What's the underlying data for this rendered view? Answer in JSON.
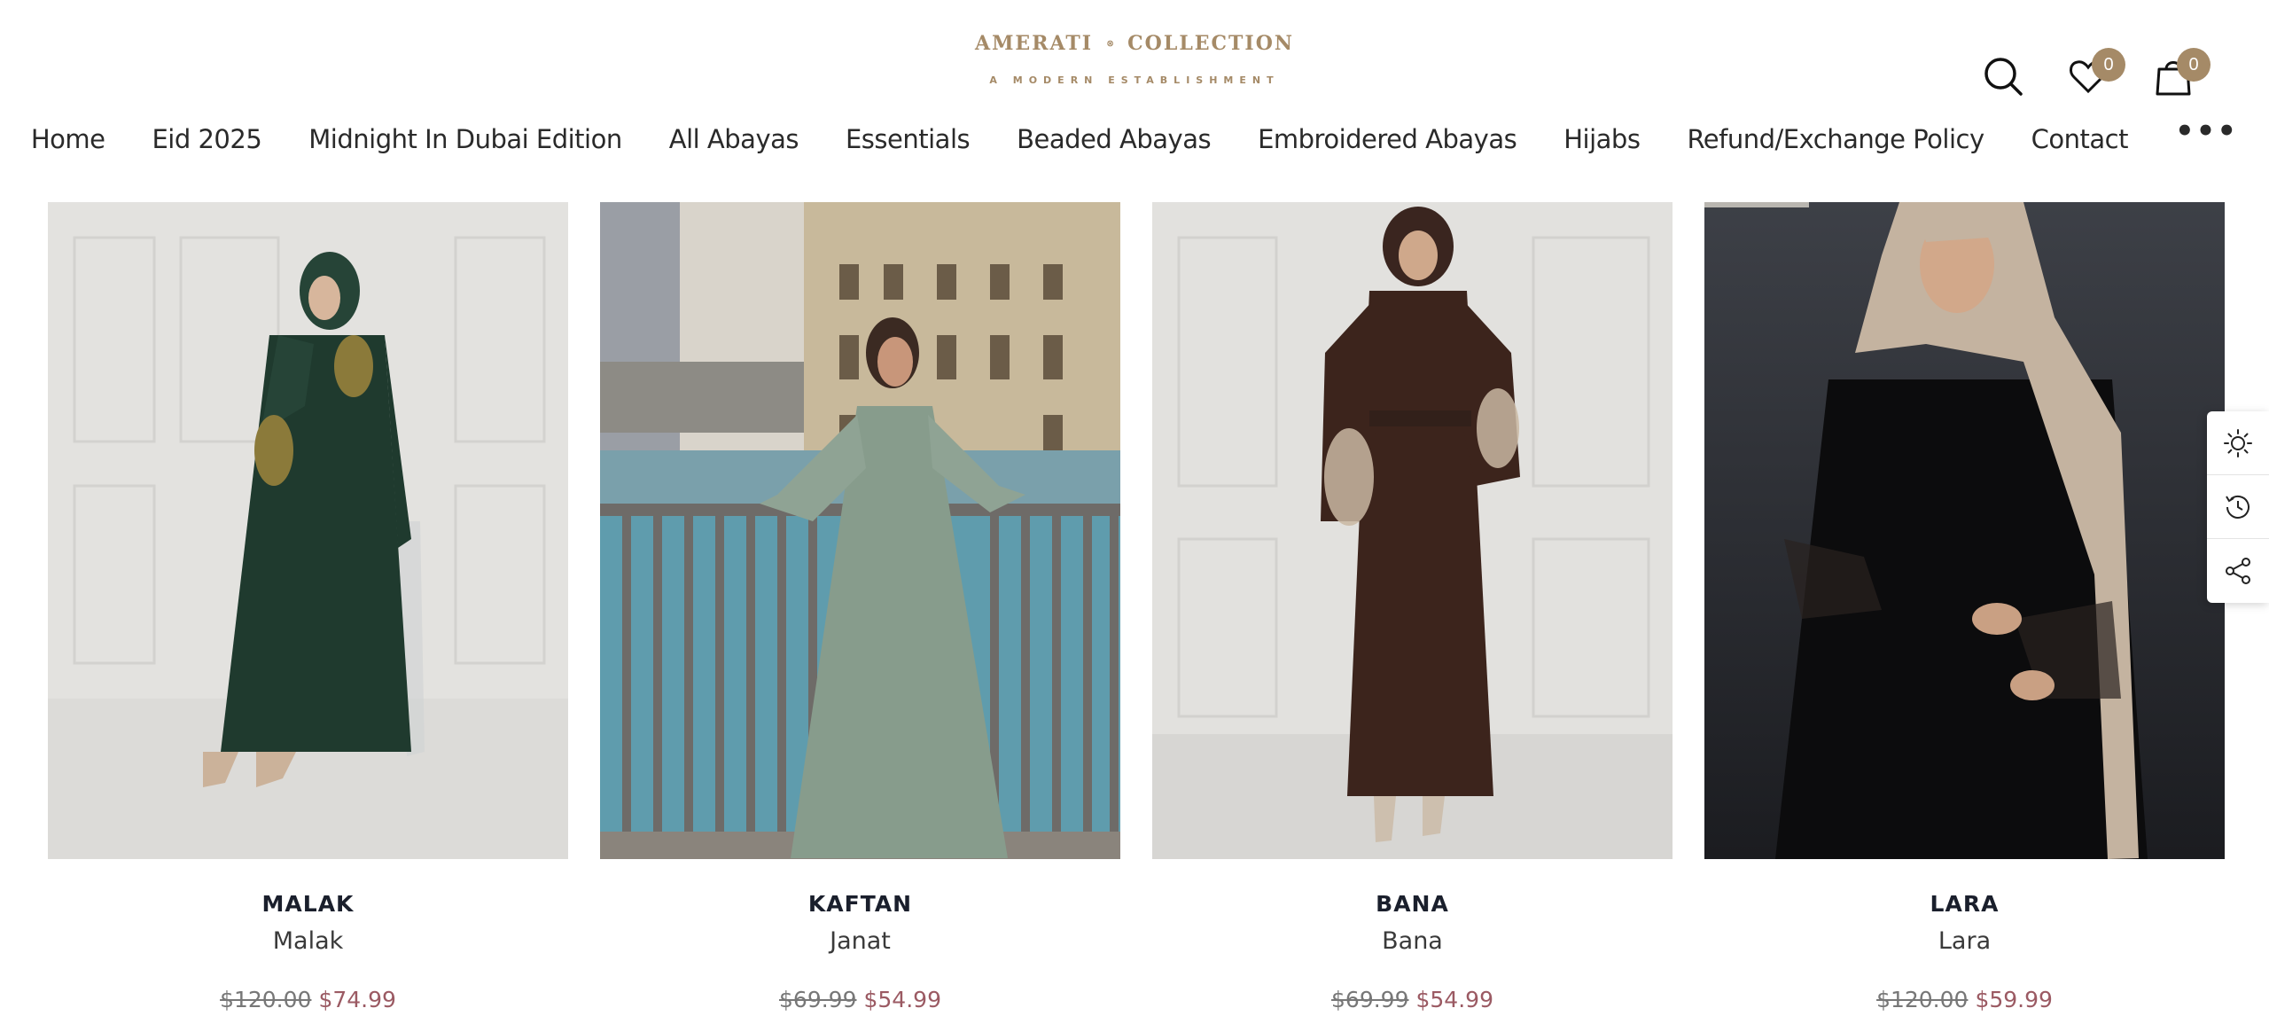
{
  "logo": {
    "left_word": "AMERATI",
    "right_word": "COLLECTION",
    "tagline": "A MODERN ESTABLISHMENT",
    "color": "#a58a67"
  },
  "header": {
    "wishlist_count": "0",
    "cart_count": "0"
  },
  "nav": {
    "items": [
      "Home",
      "Eid 2025",
      "Midnight In Dubai Edition",
      "All Abayas",
      "Essentials",
      "Beaded Abayas",
      "Embroidered Abayas",
      "Hijabs",
      "Refund/Exchange Policy",
      "Contact"
    ],
    "more": "•••"
  },
  "products": [
    {
      "title": "MALAK",
      "subtitle": "Malak",
      "old_price": "$120.00",
      "new_price": "$74.99"
    },
    {
      "title": "KAFTAN",
      "subtitle": "Janat",
      "old_price": "$69.99",
      "new_price": "$54.99"
    },
    {
      "title": "BANA",
      "subtitle": "Bana",
      "old_price": "$69.99",
      "new_price": "$54.99"
    },
    {
      "title": "LARA",
      "subtitle": "Lara",
      "old_price": "$120.00",
      "new_price": "$59.99"
    }
  ],
  "colors": {
    "accent": "#a58a67",
    "sale": "#9b5a63",
    "title": "#1a1f2c"
  },
  "tools": [
    "sun-icon",
    "history-icon",
    "share-icon"
  ]
}
